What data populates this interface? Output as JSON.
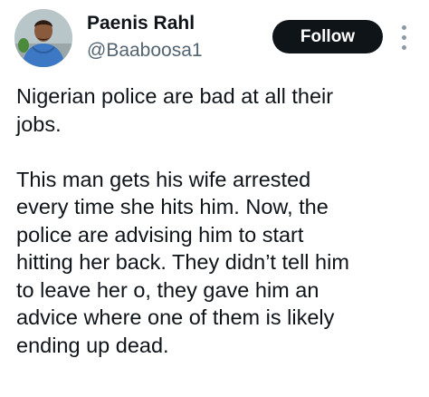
{
  "author": {
    "name": "Paenis Rahl",
    "handle": "@Baaboosa1"
  },
  "actions": {
    "follow_label": "Follow"
  },
  "icons": {
    "avatar": "profile-avatar",
    "more": "more-options-icon"
  },
  "tweet": {
    "paragraphs": [
      {
        "lines": [
          "Nigerian police are bad at all their",
          "jobs."
        ]
      },
      {
        "lines": [
          "This man gets his wife arrested",
          "every time she hits him. Now, the",
          "police are advising him to start",
          "hitting her back. They didn’t tell him",
          "to leave her o, they gave him an",
          "advice where one of them is likely",
          "ending up dead."
        ]
      }
    ]
  },
  "colors": {
    "text": "#0f1419",
    "secondary_text": "#536471",
    "button_bg": "#0f1419",
    "button_text": "#ffffff"
  }
}
